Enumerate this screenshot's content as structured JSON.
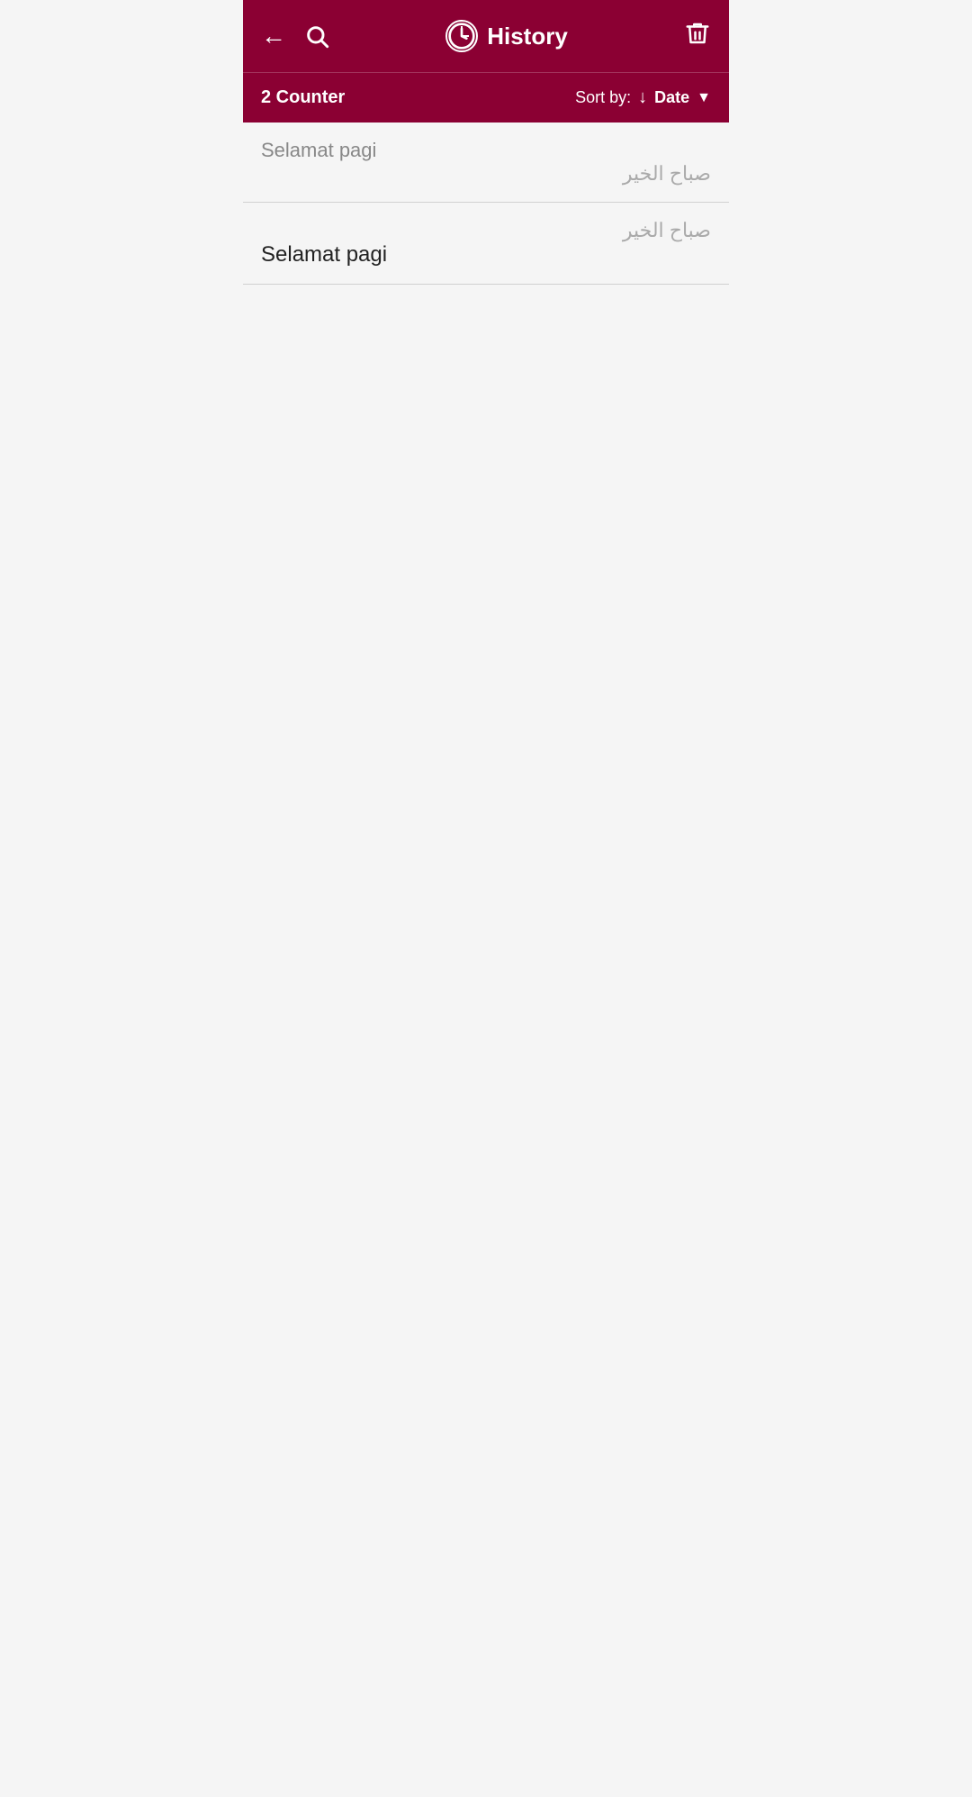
{
  "header": {
    "title": "History",
    "back_label": "←",
    "search_label": "🔍",
    "clock_label": "⏱",
    "trash_label": "🗑"
  },
  "subheader": {
    "counter_label": "2 Counter",
    "sort_by_label": "Sort by:",
    "sort_direction": "↓",
    "sort_value": "Date",
    "dropdown_arrow": "▼"
  },
  "items": [
    {
      "id": 1,
      "original": "Selamat pagi",
      "translation": "صباح الخير",
      "original_style": "light",
      "translation_style": "dark"
    },
    {
      "id": 2,
      "original": "Selamat pagi",
      "translation": "صباح الخير",
      "original_style": "dark",
      "translation_style": "light"
    }
  ]
}
